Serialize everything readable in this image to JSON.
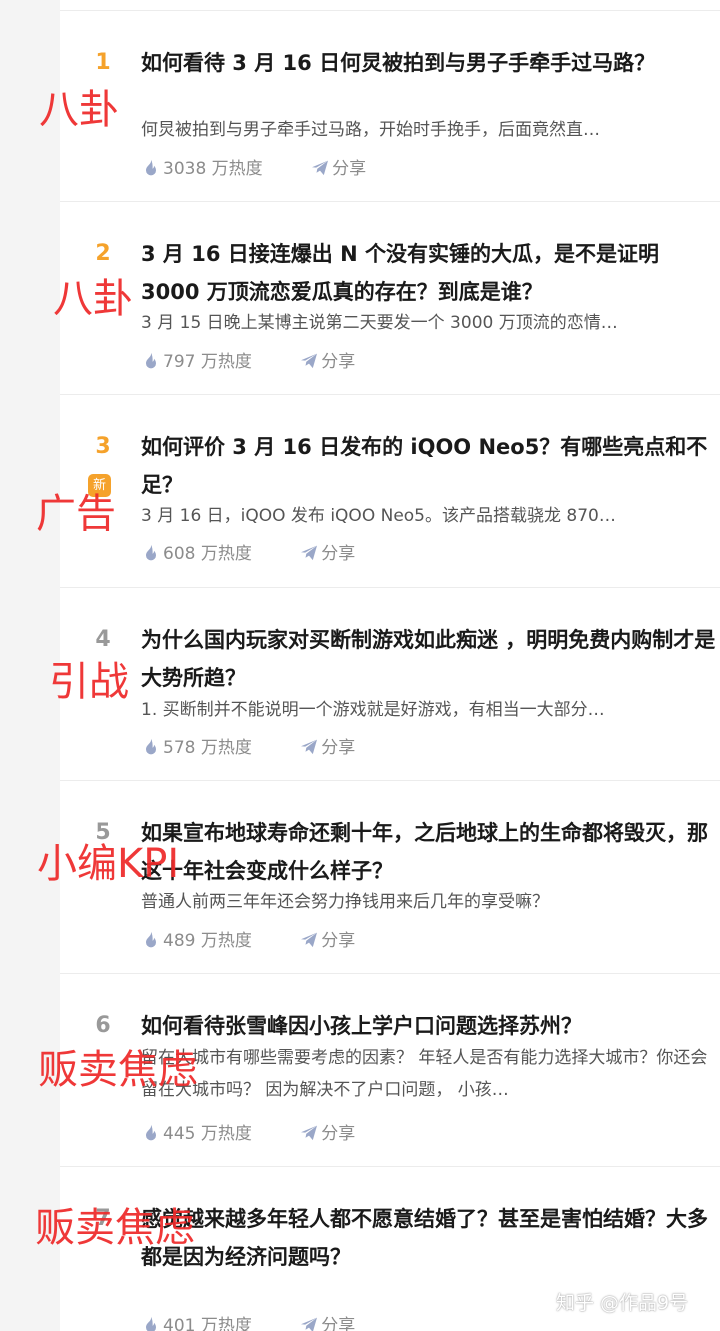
{
  "hot_list": {
    "items": [
      {
        "rank": "1",
        "title": "如何看待 3 月 16 日何炅被拍到与男子手牵手过马路？",
        "excerpt": "何炅被拍到与男子牵手过马路，开始时手挽手，后面竟然直…",
        "heat": "3038 万热度",
        "share": "分享",
        "annotation": "八卦"
      },
      {
        "rank": "2",
        "title": "3 月 16 日接连爆出 N 个没有实锤的大瓜，是不是证明 3000 万顶流恋爱瓜真的存在？到底是谁？",
        "excerpt": "3 月 15 日晚上某博主说第二天要发一个 3000 万顶流的恋情…",
        "heat": "797 万热度",
        "share": "分享",
        "annotation": "八卦"
      },
      {
        "rank": "3",
        "badge": "新",
        "title": "如何评价 3 月 16 日发布的 iQOO Neo5？有哪些亮点和不足？",
        "excerpt": "3 月 16 日，iQOO 发布 iQOO Neo5。该产品搭载骁龙 870…",
        "heat": "608 万热度",
        "share": "分享",
        "annotation": "广告"
      },
      {
        "rank": "4",
        "title": "为什么国内玩家对买断制游戏如此痴迷 ，明明免费内购制才是大势所趋？",
        "excerpt": "1. 买断制并不能说明一个游戏就是好游戏，有相当一大部分…",
        "heat": "578 万热度",
        "share": "分享",
        "annotation": "引战"
      },
      {
        "rank": "5",
        "title": "如果宣布地球寿命还剩十年，之后地球上的生命都将毁灭，那这十年社会变成什么样子？",
        "excerpt": "普通人前两三年年还会努力挣钱用来后几年的享受嘛？",
        "heat": "489 万热度",
        "share": "分享",
        "annotation": "小编KPI"
      },
      {
        "rank": "6",
        "title": "如何看待张雪峰因小孩上学户口问题选择苏州？",
        "excerpt": "留在大城市有哪些需要考虑的因素？ 年轻人是否有能力选择大城市？你还会留在大城市吗？ 因为解决不了户口问题， 小孩…",
        "heat": "445 万热度",
        "share": "分享",
        "annotation": "贩卖焦虑"
      },
      {
        "rank": "7",
        "title": "感觉越来越多年轻人都不愿意结婚了？甚至是害怕结婚？大多都是因为经济问题吗？",
        "excerpt": "",
        "heat": "401 万热度",
        "share": "分享",
        "annotation": "贩卖焦虑"
      }
    ]
  },
  "watermark": "知乎 @作品9号",
  "colors": {
    "rank_hot": "#f5a22b",
    "rank_normal": "#999999",
    "annotation_red": "#ee2a2a"
  },
  "icons": {
    "heat": "flame-icon",
    "share": "paper-plane-icon"
  }
}
